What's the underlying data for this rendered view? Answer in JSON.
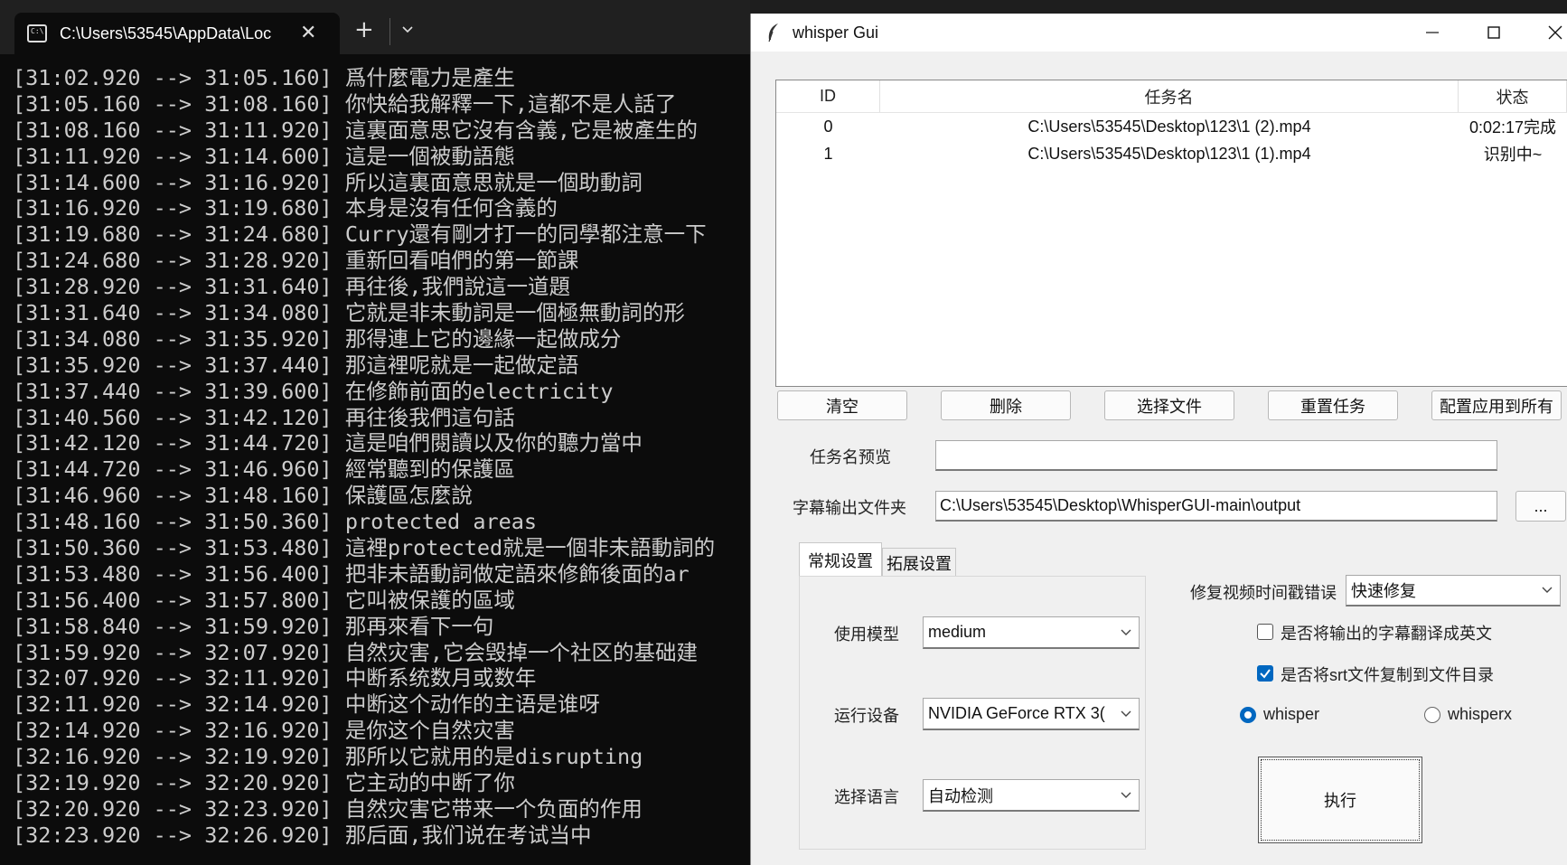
{
  "terminal": {
    "tab_title": "C:\\Users\\53545\\AppData\\Loc",
    "lines": [
      "[31:02.920 --> 31:05.160] 爲什麼電力是產生",
      "[31:05.160 --> 31:08.160] 你快給我解釋一下,這都不是人話了",
      "[31:08.160 --> 31:11.920] 這裏面意思它沒有含義,它是被產生的",
      "[31:11.920 --> 31:14.600] 這是一個被動語態",
      "[31:14.600 --> 31:16.920] 所以這裏面意思就是一個助動詞",
      "[31:16.920 --> 31:19.680] 本身是沒有任何含義的",
      "[31:19.680 --> 31:24.680] Curry還有剛才打一的同學都注意一下",
      "[31:24.680 --> 31:28.920] 重新回看咱們的第一節課",
      "[31:28.920 --> 31:31.640] 再往後,我們說這一道題",
      "[31:31.640 --> 31:34.080] 它就是非未動詞是一個極無動詞的形",
      "[31:34.080 --> 31:35.920] 那得連上它的邊緣一起做成分",
      "[31:35.920 --> 31:37.440] 那這裡呢就是一起做定語",
      "[31:37.440 --> 31:39.600] 在修飾前面的electricity",
      "[31:40.560 --> 31:42.120] 再往後我們這句話",
      "[31:42.120 --> 31:44.720] 這是咱們閱讀以及你的聽力當中",
      "[31:44.720 --> 31:46.960] 經常聽到的保護區",
      "[31:46.960 --> 31:48.160] 保護區怎麼說",
      "[31:48.160 --> 31:50.360] protected areas",
      "[31:50.360 --> 31:53.480] 這裡protected就是一個非未語動詞的",
      "[31:53.480 --> 31:56.400] 把非未語動詞做定語來修飾後面的ar",
      "[31:56.400 --> 31:57.800] 它叫被保護的區域",
      "[31:58.840 --> 31:59.920] 那再來看下一句",
      "[31:59.920 --> 32:07.920] 自然灾害,它会毁掉一个社区的基础建",
      "[32:07.920 --> 32:11.920] 中断系统数月或数年",
      "[32:11.920 --> 32:14.920] 中断这个动作的主语是谁呀",
      "[32:14.920 --> 32:16.920] 是你这个自然灾害",
      "[32:16.920 --> 32:19.920] 那所以它就用的是disrupting",
      "[32:19.920 --> 32:20.920] 它主动的中断了你",
      "[32:20.920 --> 32:23.920] 自然灾害它带来一个负面的作用",
      "[32:23.920 --> 32:26.920] 那后面,我们说在考试当中"
    ]
  },
  "gui": {
    "title": "whisper Gui",
    "table": {
      "headers": [
        "ID",
        "任务名",
        "状态"
      ],
      "rows": [
        {
          "id": "0",
          "name": "C:\\Users\\53545\\Desktop\\123\\1 (2).mp4",
          "status": "0:02:17完成"
        },
        {
          "id": "1",
          "name": "C:\\Users\\53545\\Desktop\\123\\1 (1).mp4",
          "status": "识别中~"
        }
      ]
    },
    "buttons": {
      "clear": "清空",
      "delete": "删除",
      "select_file": "选择文件",
      "reset_task": "重置任务",
      "apply_all": "配置应用到所有"
    },
    "preview_label": "任务名预览",
    "preview_value": "",
    "output_label": "字幕输出文件夹",
    "output_value": "C:\\Users\\53545\\Desktop\\WhisperGUI-main\\output",
    "browse_label": "...",
    "tabs": [
      "常规设置",
      "拓展设置"
    ],
    "model_label": "使用模型",
    "model_value": "medium",
    "device_label": "运行设备",
    "device_value": "NVIDIA GeForce RTX 3(",
    "language_label": "选择语言",
    "language_value": "自动检测",
    "fix_label": "修复视频时间戳错误",
    "fix_value": "快速修复",
    "translate_label": "是否将输出的字幕翻译成英文",
    "translate_checked": false,
    "copy_srt_label": "是否将srt文件复制到文件目录",
    "copy_srt_checked": true,
    "engine_options": [
      "whisper",
      "whisperx"
    ],
    "engine_selected": "whisper",
    "execute_label": "执行",
    "colors": {
      "accent": "#0067c0",
      "terminal_bg": "#0c0c0c",
      "terminal_text": "#cccccc"
    }
  }
}
